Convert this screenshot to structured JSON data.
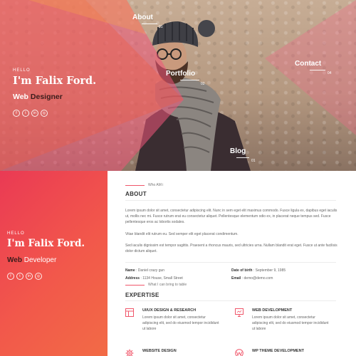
{
  "hero": {
    "hello": "HELLO",
    "name": "I'm Falix Ford.",
    "role_word1": "Web",
    "role_word2": "Designer",
    "social": [
      {
        "icon": "facebook-icon",
        "glyph": "f"
      },
      {
        "icon": "twitter-icon",
        "glyph": "t"
      },
      {
        "icon": "linkedin-icon",
        "glyph": "in"
      },
      {
        "icon": "dribbble-icon",
        "glyph": "◎"
      }
    ]
  },
  "nav": [
    {
      "label": "About",
      "num": "01"
    },
    {
      "label": "Portfolio",
      "num": "02"
    },
    {
      "label": "Contact",
      "num": "04"
    },
    {
      "label": "Blog",
      "num": "01"
    }
  ],
  "panel": {
    "hello": "HELLO",
    "name": "I'm Falix Ford.",
    "role_word1": "Web",
    "role_word2": "Developer",
    "social": [
      {
        "icon": "facebook-icon",
        "glyph": "f"
      },
      {
        "icon": "twitter-icon",
        "glyph": "t"
      },
      {
        "icon": "linkedin-icon",
        "glyph": "in"
      },
      {
        "icon": "dribbble-icon",
        "glyph": "◎"
      }
    ]
  },
  "about": {
    "tagline": "Who AM i",
    "title": "ABOUT",
    "paragraph1": "Lorem ipsum dolor sit amet, consectetur adipiscing elit. Nunc in sem eget elit maximus commodo. Fusce ligula ex, dapibus eget iaculis ut, mollis nec mi. Fusce rutrum erat eu consectetur aliquet. Pellentesque elementum odio ex, in placerat neque tempus sed. Fusce pellentesque eros ac lobortis sodales.",
    "paragraph2": "Vitae blandit elit rutrum eu. Sed semper elit eget placerat condimentum.",
    "paragraph3": "Sed iaculis dignissim est tempor sagittis. Praesent a rhoncus mauris, sed ultricies urna. Nullam blandit erat eget. Fusce ut ante facilisis dolor dictum aliquet.",
    "name_label": "Name",
    "name_value": "Daniel crazy gun",
    "dob_label": "Date of birth",
    "dob_value": "September 9, 1985",
    "address_label": "Address",
    "address_value": "1134 House, Small Street",
    "email_label": "Email",
    "email_value": "demo@demo.com"
  },
  "expertise": {
    "tagline": "What I can bring to table",
    "title": "EXPERTISE",
    "services": [
      {
        "icon": "layout-icon",
        "title": "UI/UX DESIGN & RESEARCH",
        "text": "Lorem ipsum dolor sit amet, consectetur adipiscing elit, sed do eiusmod tempor incididunt ut labore"
      },
      {
        "icon": "monitor-icon",
        "title": "WEB DEVELOPMENT",
        "text": "Lorem ipsum dolor sit amet, consectetur adipiscing elit, sed do eiusmod tempor incididunt ut labore"
      },
      {
        "icon": "gear-icon",
        "title": "WEBSITE DESIGN",
        "text": ""
      },
      {
        "icon": "wordpress-icon",
        "title": "WP THEME DEVELOPMENT",
        "text": ""
      }
    ]
  },
  "colors": {
    "accent": "#f0566a",
    "panel_start": "#ea3a54",
    "panel_end": "#f26b46",
    "dark_text": "#3a1c1c"
  }
}
